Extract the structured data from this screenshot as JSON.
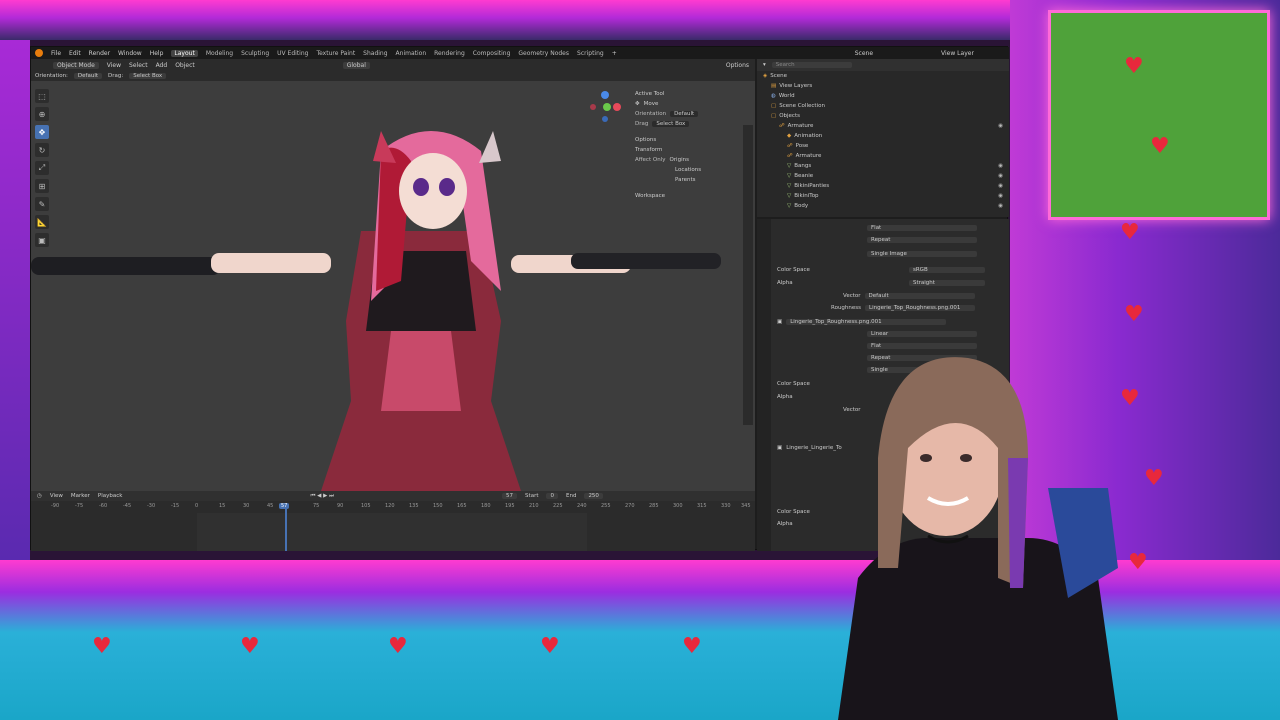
{
  "menubar": {
    "items": [
      "File",
      "Edit",
      "Render",
      "Window",
      "Help"
    ],
    "workspaces": [
      "Layout",
      "Modeling",
      "Sculpting",
      "UV Editing",
      "Texture Paint",
      "Shading",
      "Animation",
      "Rendering",
      "Compositing",
      "Geometry Nodes",
      "Scripting"
    ],
    "active_workspace": "Layout",
    "scene": "Scene",
    "view_layer": "View Layer"
  },
  "header": {
    "mode": "Object Mode",
    "menus": [
      "View",
      "Select",
      "Add",
      "Object"
    ],
    "transform": "Global",
    "options": "Options"
  },
  "header2": {
    "orientation_label": "Orientation:",
    "orientation_value": "Default",
    "drag_label": "Drag:",
    "drag_value": "Select Box"
  },
  "npanel": {
    "active_tool": "Active Tool",
    "tool_name": "Move",
    "orientation_label": "Orientation",
    "orientation_value": "Default",
    "drag_label": "Drag",
    "drag_value": "Select Box",
    "options": "Options",
    "transform": "Transform",
    "affect_only": "Affect Only",
    "origins": "Origins",
    "locations": "Locations",
    "parents": "Parents",
    "workspace": "Workspace"
  },
  "timeline": {
    "menus": [
      "View",
      "Marker",
      "Playback"
    ],
    "current_frame": "57",
    "start_label": "Start",
    "start_value": "0",
    "end_label": "End",
    "end_value": "250",
    "ruler": [
      "-90",
      "-75",
      "-60",
      "-45",
      "-30",
      "-15",
      "0",
      "15",
      "30",
      "45",
      "57",
      "75",
      "90",
      "105",
      "120",
      "135",
      "150",
      "165",
      "180",
      "195",
      "210",
      "225",
      "240",
      "255",
      "270",
      "285",
      "300",
      "315",
      "330",
      "345"
    ]
  },
  "outliner": {
    "search_placeholder": "Search",
    "items": [
      {
        "label": "Scene",
        "indent": 0,
        "icon": "scene-icon"
      },
      {
        "label": "View Layers",
        "indent": 1,
        "icon": "layers-icon"
      },
      {
        "label": "World",
        "indent": 1,
        "icon": "world-icon"
      },
      {
        "label": "Scene Collection",
        "indent": 1,
        "icon": "collection-icon"
      },
      {
        "label": "Objects",
        "indent": 1,
        "icon": "objects-icon"
      },
      {
        "label": "Armature",
        "indent": 2,
        "icon": "armature-icon"
      },
      {
        "label": "Animation",
        "indent": 3,
        "icon": "animation-icon"
      },
      {
        "label": "Pose",
        "indent": 3,
        "icon": "pose-icon"
      },
      {
        "label": "Armature",
        "indent": 3,
        "icon": "armature-data-icon"
      },
      {
        "label": "Bangs",
        "indent": 3,
        "icon": "mesh-icon"
      },
      {
        "label": "Beanie",
        "indent": 3,
        "icon": "mesh-icon"
      },
      {
        "label": "BikiniPanties",
        "indent": 3,
        "icon": "mesh-icon"
      },
      {
        "label": "BikiniTop",
        "indent": 3,
        "icon": "mesh-icon"
      },
      {
        "label": "Body",
        "indent": 3,
        "icon": "mesh-icon"
      }
    ]
  },
  "properties": {
    "flat_top": "Flat",
    "repeat_top": "Repeat",
    "single_image_top": "Single Image",
    "color_space_label": "Color Space",
    "color_space_value": "sRGB",
    "alpha_label": "Alpha",
    "alpha_value": "Straight",
    "vector_label": "Vector",
    "vector_value": "Default",
    "roughness_label": "Roughness",
    "roughness_value": "Lingerie_Top_Roughness.png.001",
    "image_name": "Lingerie_Top_Roughness.png.001",
    "interp": "Linear",
    "proj": "Flat",
    "ext": "Repeat",
    "single": "Single",
    "color_space_2": "Color Space",
    "alpha_2": "Alpha",
    "vector_2": "Vector",
    "tex_name_2": "Lingerie_Lingerie_To",
    "color_space_3": "Color Space",
    "alpha_3": "Alpha"
  },
  "colors": {
    "accent": "#4772b3",
    "blender_orange": "#e87d0d",
    "heart": "#e8283c",
    "green_panel": "#4fa23a"
  }
}
